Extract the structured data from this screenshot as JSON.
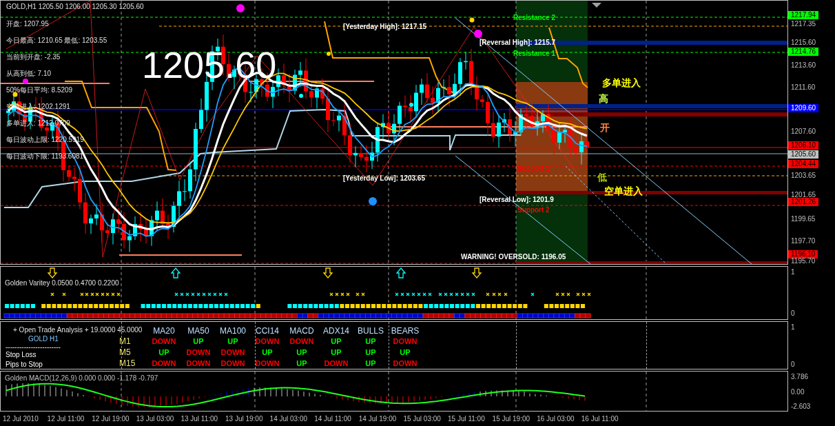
{
  "title_line": "GOLD,H1  1205.50 1206.00 1205.30 1205.60",
  "big_price": "1205.60",
  "info_lines": [
    "开盘: 1207.95",
    "今日最高: 1210.65  最低: 1203.55",
    "当前到开盘: -2.35",
    "从高到低: 7.10",
    "50%每日平均: 8.5209",
    "空单进入: 1202.1291",
    "多单进入: 1212.0709",
    "每日波动上限: 1220.5919",
    "每日波动下限: 1193.6081"
  ],
  "chart_labels": [
    {
      "text": "[Yesterday High]: 1217.15",
      "color": "#ffffff"
    },
    {
      "text": "Resistance 2",
      "color": "#00ff00"
    },
    {
      "text": "[Reversal High]: 1215.7",
      "color": "#ffffff"
    },
    {
      "text": "Resistance 1",
      "color": "#00ff00"
    },
    {
      "text": "Support 1",
      "color": "#ff0000"
    },
    {
      "text": "[Yesterday Low]: 1203.65",
      "color": "#ffffff"
    },
    {
      "text": "[Reversal Low]: 1201.9",
      "color": "#ffffff"
    },
    {
      "text": "Support 2",
      "color": "#ff0000"
    },
    {
      "text": "WARNING! OVERSOLD: 1196.05",
      "color": "#ffffff"
    },
    {
      "text": "多单进入",
      "color": "#ffff00"
    },
    {
      "text": "高",
      "color": "#c8ff50"
    },
    {
      "text": "开",
      "color": "#ff8040"
    },
    {
      "text": "低",
      "color": "#a8c800"
    },
    {
      "text": "空单进入",
      "color": "#ffff00"
    }
  ],
  "price_axis": [
    {
      "text": "1217.94",
      "kind": "tag",
      "color": "#00ff00"
    },
    {
      "text": "1217.35",
      "kind": "tick"
    },
    {
      "text": "1215.60",
      "kind": "tick"
    },
    {
      "text": "1214.76",
      "kind": "tag",
      "color": "#00ff00"
    },
    {
      "text": "1213.60",
      "kind": "tick"
    },
    {
      "text": "1211.60",
      "kind": "tick"
    },
    {
      "text": "1209.60",
      "kind": "tag",
      "color": "#0000ff"
    },
    {
      "text": "1207.60",
      "kind": "tick"
    },
    {
      "text": "1206.10",
      "kind": "tag",
      "color": "#ff0000"
    },
    {
      "text": "1205.60",
      "kind": "tag",
      "color": "#c0c0c0"
    },
    {
      "text": "1204.44",
      "kind": "tag",
      "color": "#ff0000"
    },
    {
      "text": "1203.65",
      "kind": "tick"
    },
    {
      "text": "1201.65",
      "kind": "tick"
    },
    {
      "text": "1201.26",
      "kind": "tag",
      "color": "#ff0000"
    },
    {
      "text": "1199.65",
      "kind": "tick"
    },
    {
      "text": "1197.70",
      "kind": "tick"
    },
    {
      "text": "1196.10",
      "kind": "tag",
      "color": "#ff0000"
    },
    {
      "text": "1195.70",
      "kind": "tick"
    }
  ],
  "indicator_panel": {
    "title": "Golden Varitey 0.0500 0.4700 0.2200",
    "axis": [
      "1",
      "0"
    ]
  },
  "trade_panel": {
    "header": "+ Open Trade Analysis + 19.0000 45.0000",
    "symbol": "GOLD  H1",
    "divider": "------------------------",
    "stop_loss": "Stop Loss",
    "pips_to_stop": "Pips to Stop",
    "columns": [
      "MA20",
      "MA50",
      "MA100",
      "CCI14",
      "MACD",
      "ADX14",
      "BULLS",
      "BEARS"
    ],
    "rows": [
      {
        "label": "M1",
        "cells": [
          {
            "text": "DOWN",
            "color": "#ff0000"
          },
          {
            "text": "UP",
            "color": "#00ff00"
          },
          {
            "text": "UP",
            "color": "#00ff00"
          },
          {
            "text": "DOWN",
            "color": "#ff0000"
          },
          {
            "text": "DOWN",
            "color": "#ff0000"
          },
          {
            "text": "UP",
            "color": "#00ff00"
          },
          {
            "text": "UP",
            "color": "#00ff00"
          },
          {
            "text": "DOWN",
            "color": "#ff0000"
          }
        ]
      },
      {
        "label": "M5",
        "cells": [
          {
            "text": "UP",
            "color": "#00ff00"
          },
          {
            "text": "DOWN",
            "color": "#ff0000"
          },
          {
            "text": "DOWN",
            "color": "#ff0000"
          },
          {
            "text": "UP",
            "color": "#00ff00"
          },
          {
            "text": "UP",
            "color": "#00ff00"
          },
          {
            "text": "UP",
            "color": "#00ff00"
          },
          {
            "text": "UP",
            "color": "#00ff00"
          },
          {
            "text": "UP",
            "color": "#00ff00"
          }
        ]
      },
      {
        "label": "M15",
        "cells": [
          {
            "text": "DOWN",
            "color": "#ff0000"
          },
          {
            "text": "DOWN",
            "color": "#ff0000"
          },
          {
            "text": "DOWN",
            "color": "#ff0000"
          },
          {
            "text": "DOWN",
            "color": "#ff0000"
          },
          {
            "text": "UP",
            "color": "#00ff00"
          },
          {
            "text": "DOWN",
            "color": "#ff0000"
          },
          {
            "text": "UP",
            "color": "#00ff00"
          },
          {
            "text": "DOWN",
            "color": "#ff0000"
          }
        ]
      }
    ],
    "axis": [
      "1",
      "0"
    ]
  },
  "macd_panel": {
    "title": "Golden MACD(12,26,9) 0.000 0.000 -1.178 -0.797",
    "axis": [
      "3.786",
      "0.00",
      "-2.603"
    ]
  },
  "time_axis": [
    "12 Jul 2010",
    "12 Jul 11:00",
    "12 Jul 19:00",
    "13 Jul 03:00",
    "13 Jul 11:00",
    "13 Jul 19:00",
    "14 Jul 03:00",
    "14 Jul 11:00",
    "14 Jul 19:00",
    "15 Jul 03:00",
    "15 Jul 11:00",
    "15 Jul 19:00",
    "16 Jul 03:00",
    "16 Jul 11:00"
  ]
}
